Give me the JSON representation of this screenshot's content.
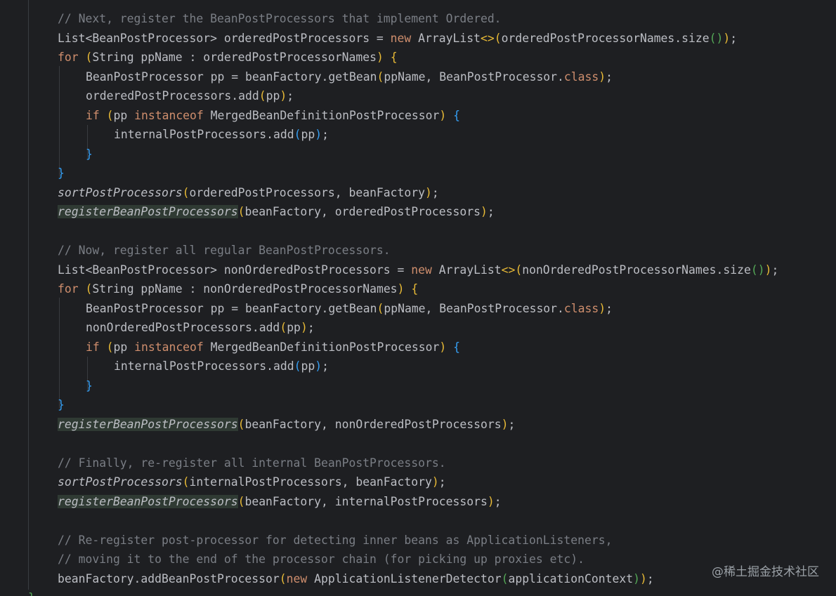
{
  "editor": {
    "lines": [
      {
        "indent": 1,
        "kind": "comment",
        "text": "// Next, register the BeanPostProcessors that implement Ordered."
      },
      {
        "indent": 1,
        "kind": "code",
        "text": "List<BeanPostProcessor> orderedPostProcessors = new ArrayList<>(orderedPostProcessorNames.size());"
      },
      {
        "indent": 1,
        "kind": "code",
        "text": "for (String ppName : orderedPostProcessorNames) {"
      },
      {
        "indent": 2,
        "kind": "code",
        "text": "BeanPostProcessor pp = beanFactory.getBean(ppName, BeanPostProcessor.class);"
      },
      {
        "indent": 2,
        "kind": "code",
        "text": "orderedPostProcessors.add(pp);"
      },
      {
        "indent": 2,
        "kind": "code",
        "text": "if (pp instanceof MergedBeanDefinitionPostProcessor) {"
      },
      {
        "indent": 3,
        "kind": "code",
        "text": "internalPostProcessors.add(pp);"
      },
      {
        "indent": 2,
        "kind": "code",
        "text": "}"
      },
      {
        "indent": 1,
        "kind": "code",
        "text": "}"
      },
      {
        "indent": 1,
        "kind": "code",
        "text": "sortPostProcessors(orderedPostProcessors, beanFactory);"
      },
      {
        "indent": 1,
        "kind": "code",
        "text": "registerBeanPostProcessors(beanFactory, orderedPostProcessors);"
      },
      {
        "indent": 1,
        "kind": "blank",
        "text": ""
      },
      {
        "indent": 1,
        "kind": "comment",
        "text": "// Now, register all regular BeanPostProcessors."
      },
      {
        "indent": 1,
        "kind": "code",
        "text": "List<BeanPostProcessor> nonOrderedPostProcessors = new ArrayList<>(nonOrderedPostProcessorNames.size());"
      },
      {
        "indent": 1,
        "kind": "code",
        "text": "for (String ppName : nonOrderedPostProcessorNames) {"
      },
      {
        "indent": 2,
        "kind": "code",
        "text": "BeanPostProcessor pp = beanFactory.getBean(ppName, BeanPostProcessor.class);"
      },
      {
        "indent": 2,
        "kind": "code",
        "text": "nonOrderedPostProcessors.add(pp);"
      },
      {
        "indent": 2,
        "kind": "code",
        "text": "if (pp instanceof MergedBeanDefinitionPostProcessor) {"
      },
      {
        "indent": 3,
        "kind": "code",
        "text": "internalPostProcessors.add(pp);"
      },
      {
        "indent": 2,
        "kind": "code",
        "text": "}"
      },
      {
        "indent": 1,
        "kind": "code",
        "text": "}"
      },
      {
        "indent": 1,
        "kind": "code",
        "text": "registerBeanPostProcessors(beanFactory, nonOrderedPostProcessors);"
      },
      {
        "indent": 1,
        "kind": "blank",
        "text": ""
      },
      {
        "indent": 1,
        "kind": "comment",
        "text": "// Finally, re-register all internal BeanPostProcessors."
      },
      {
        "indent": 1,
        "kind": "code",
        "text": "sortPostProcessors(internalPostProcessors, beanFactory);"
      },
      {
        "indent": 1,
        "kind": "code",
        "text": "registerBeanPostProcessors(beanFactory, internalPostProcessors);"
      },
      {
        "indent": 1,
        "kind": "blank",
        "text": ""
      },
      {
        "indent": 1,
        "kind": "comment",
        "text": "// Re-register post-processor for detecting inner beans as ApplicationListeners,"
      },
      {
        "indent": 1,
        "kind": "comment",
        "text": "// moving it to the end of the processor chain (for picking up proxies etc)."
      },
      {
        "indent": 1,
        "kind": "code",
        "text": "beanFactory.addBeanPostProcessor(new ApplicationListenerDetector(applicationContext));"
      },
      {
        "indent": 0,
        "kind": "code",
        "text": "}"
      }
    ],
    "keywords": [
      "new",
      "for",
      "if",
      "instanceof",
      "class"
    ],
    "italic_methods": [
      "sortPostProcessors",
      "registerBeanPostProcessors"
    ],
    "highlighted_methods": [
      "registerBeanPostProcessors"
    ],
    "colors": {
      "background": "#1e1f22",
      "default_text": "#bcbec4",
      "comment": "#7a7e85",
      "keyword": "#cf8e6d",
      "highlight_bg": "#2f3a33",
      "bracket_level_1": "#e8ba36",
      "bracket_level_2": "#54a857",
      "bracket_level_3": "#359ff4"
    }
  },
  "watermark": {
    "text": "@稀土掘金技术社区"
  }
}
